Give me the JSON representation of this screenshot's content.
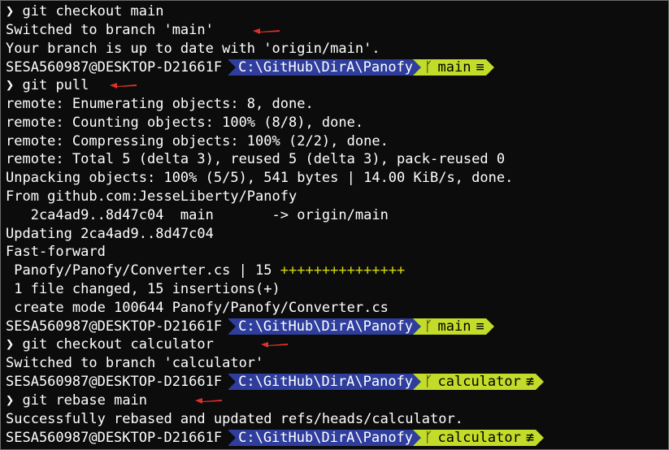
{
  "terminal": {
    "prompt": {
      "user_host": "SESA560987@DESKTOP-D21661F",
      "path": "C:\\GitHub\\DirA\\Panofy",
      "branch_icon": "ᚴ",
      "prompt_symbol": "❯"
    },
    "cmd1": "git checkout main",
    "l1": "Switched to branch 'main'",
    "l2": "Your branch is up to date with 'origin/main'.",
    "p1_branch": "main",
    "p1_status": "≡",
    "cmd2": "git pull",
    "l3": "remote: Enumerating objects: 8, done.",
    "l4": "remote: Counting objects: 100% (8/8), done.",
    "l5": "remote: Compressing objects: 100% (2/2), done.",
    "l6": "remote: Total 5 (delta 3), reused 5 (delta 3), pack-reused 0",
    "l7": "Unpacking objects: 100% (5/5), 541 bytes | 14.00 KiB/s, done.",
    "l8": "From github.com:JesseLiberty/Panofy",
    "l9": "   2ca4ad9..8d47c04  main       -> origin/main",
    "l10": "Updating 2ca4ad9..8d47c04",
    "l11": "Fast-forward",
    "l12": " Panofy/Panofy/Converter.cs | 15 ",
    "l12_plus": "+++++++++++++++",
    "l13": " 1 file changed, 15 insertions(+)",
    "l14": " create mode 100644 Panofy/Panofy/Converter.cs",
    "p2_branch": "main",
    "p2_status": "≡",
    "cmd3": "git checkout calculator",
    "l15": "Switched to branch 'calculator'",
    "p3_branch": "calculator",
    "p3_status": "≢",
    "cmd4": "git rebase main",
    "l16": "Successfully rebased and updated refs/heads/calculator.",
    "p4_branch": "calculator",
    "p4_status": "≢"
  },
  "colors": {
    "background": "#0c0c0c",
    "path_segment": "#2f3e9c",
    "branch_segment": "#c3dc2a",
    "annotation_arrow": "#e0302a"
  }
}
